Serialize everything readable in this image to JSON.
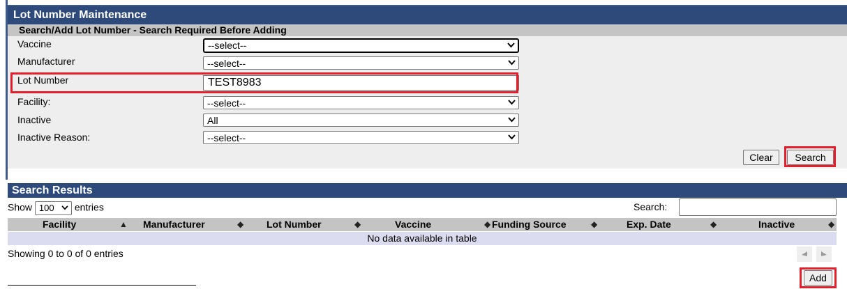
{
  "page": {
    "title": "Lot Number Maintenance",
    "subtitle": "Search/Add Lot Number - Search Required Before Adding"
  },
  "form": {
    "vaccine": {
      "label": "Vaccine",
      "value": "--select--"
    },
    "manufacturer": {
      "label": "Manufacturer",
      "value": "--select--"
    },
    "lot_number": {
      "label": "Lot Number",
      "value": "TEST8983"
    },
    "facility": {
      "label": "Facility:",
      "value": "--select--"
    },
    "inactive": {
      "label": "Inactive",
      "value": "All"
    },
    "inactive_reason": {
      "label": "Inactive Reason:",
      "value": "--select--"
    }
  },
  "buttons": {
    "clear": "Clear",
    "search": "Search",
    "add": "Add"
  },
  "results": {
    "title": "Search Results",
    "show_label": "Show",
    "entries_value": "100",
    "entries_label": "entries",
    "search_label": "Search:",
    "columns": [
      "Facility",
      "Manufacturer",
      "Lot Number",
      "Vaccine",
      "Funding Source",
      "Exp. Date",
      "Inactive"
    ],
    "empty_message": "No data available in table",
    "info": "Showing 0 to 0 of 0 entries"
  },
  "colors": {
    "header_bg": "#2e4a7a",
    "highlight": "#e0202c",
    "empty_row_bg": "#dcdcf0"
  },
  "icons": [
    "chevron-down-icon",
    "sort-asc-icon",
    "sort-both-icon",
    "previous-page-icon",
    "next-page-icon"
  ]
}
